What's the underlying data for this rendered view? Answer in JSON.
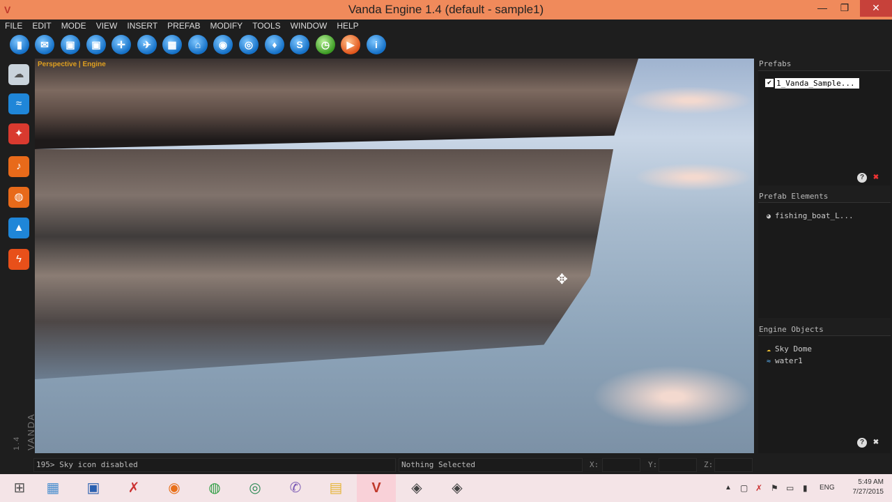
{
  "window": {
    "title": "Vanda Engine 1.4 (default - sample1)",
    "minimize": "—",
    "restore": "❐",
    "close": "✕"
  },
  "menu": [
    "FILE",
    "EDIT",
    "MODE",
    "VIEW",
    "INSERT",
    "PREFAB",
    "MODIFY",
    "TOOLS",
    "WINDOW",
    "HELP"
  ],
  "toolbar": {
    "icons": [
      "new-icon",
      "open-icon",
      "save-icon",
      "save-as-icon",
      "move-icon",
      "fly-icon",
      "grid-icon",
      "home-icon",
      "target-icon",
      "camera-icon",
      "water-icon",
      "script-icon",
      "timer-icon",
      "play-icon",
      "info-icon"
    ]
  },
  "left_tools": {
    "icons": [
      "sky-icon",
      "water-tool-icon",
      "light-icon",
      "sound-icon",
      "ambient-sound-icon",
      "trigger-icon",
      "physics-icon"
    ],
    "version_label": "VANDA",
    "version_number": "1.4"
  },
  "viewport": {
    "label": "Perspective | Engine"
  },
  "prefabs": {
    "header": "Prefabs",
    "items": [
      {
        "name": "1_Vanda_Sample...",
        "checked": true
      }
    ]
  },
  "prefab_elements": {
    "header": "Prefab Elements",
    "items": [
      {
        "name": "fishing_boat_L..."
      }
    ]
  },
  "engine_objects": {
    "header": "Engine Objects",
    "items": [
      {
        "name": "Sky Dome",
        "icon": "sky-dome-icon"
      },
      {
        "name": "water1",
        "icon": "water-object-icon"
      }
    ]
  },
  "status": {
    "console": "195> Sky icon disabled",
    "selection": "Nothing Selected",
    "x_label": "X:",
    "y_label": "Y:",
    "z_label": "Z:",
    "x_value": "",
    "y_value": "",
    "z_value": ""
  },
  "taskbar": {
    "apps": [
      "start-icon",
      "calculator-icon",
      "network-icon",
      "xmind-icon",
      "firefox-icon",
      "chrome-icon",
      "globe-icon",
      "viber-icon",
      "explorer-icon",
      "vanda-icon",
      "game-icon-1",
      "game-icon-2"
    ],
    "language": "ENG",
    "time": "5:49 AM",
    "date": "7/27/2015"
  }
}
